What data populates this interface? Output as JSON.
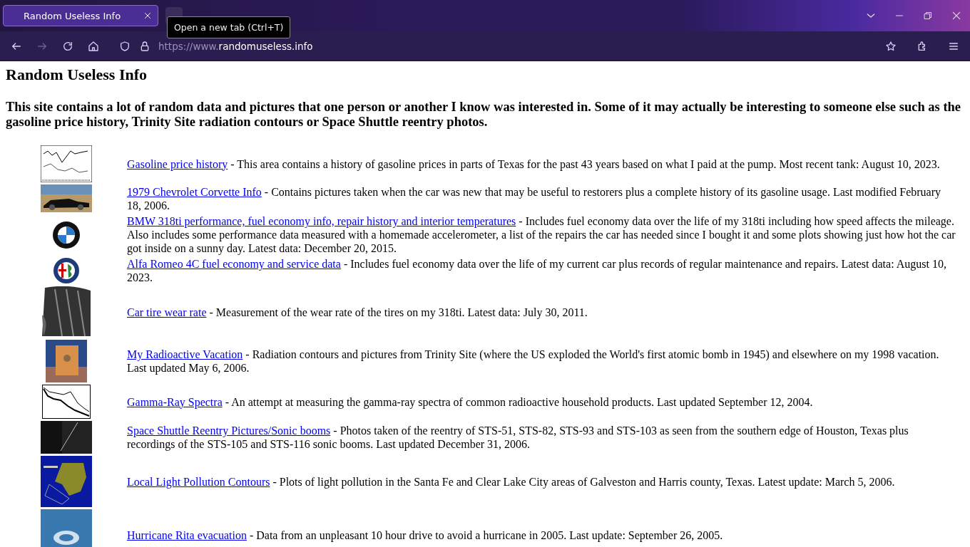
{
  "browser": {
    "tabs": [
      {
        "title": "Random Useless Info",
        "selected": true
      }
    ],
    "tooltip": "Open a new tab (Ctrl+T)",
    "url": {
      "prefix": "https://www.",
      "domain": "randomuseless.info"
    }
  },
  "page": {
    "title": "Random Useless Info",
    "intro": "This site contains a lot of random data and pictures that one person or another I know was interested in. Some of it may actually be interesting to someone else such as the gasoline price history, Trinity Site radiation contours or Space Shuttle reentry photos.",
    "entries": [
      {
        "kind": "price-chart",
        "link": "Gasoline price history",
        "text": " - This area contains a history of gasoline prices in parts of Texas for the past 43 years based on what I paid at the pump. Most recent tank: August 10, 2023."
      },
      {
        "kind": "car-photo",
        "link": "1979 Chevrolet Corvette Info",
        "text": " - Contains pictures taken when the car was new that may be useful to restorers plus a complete history of its gasoline usage. Last modified February 18, 2006."
      },
      {
        "kind": "quartered-logo",
        "link": "BMW 318ti performance, fuel economy info, repair history and interior temperatures",
        "text": " - Includes fuel economy data over the life of my 318ti including how speed affects the mileage. Also includes some performance data measured with a homemade accelerometer, a list of the repairs the car has needed since I bought it and some plots showing just how hot the car got inside on a sunny day. Latest data: December 20, 2015."
      },
      {
        "kind": "split-logo",
        "link": "Alfa Romeo 4C fuel economy and service data",
        "text": " - Includes fuel economy data over the life of my current car plus records of regular maintenance and repairs. Latest data: August 10, 2023."
      },
      {
        "kind": "tire-photo",
        "link": "Car tire wear rate",
        "text": " - Measurement of the wear rate of the tires on my 318ti. Latest data: July 30, 2011."
      },
      {
        "kind": "sign-photo",
        "link": "My Radioactive Vacation",
        "text": " - Radiation contours and pictures from Trinity Site (where the US exploded the World's first atomic bomb in 1945) and elsewhere on my 1998 vacation. Last updated May 6, 2006."
      },
      {
        "kind": "spectrum-chart",
        "link": "Gamma-Ray Spectra",
        "text": " - An attempt at measuring the gamma-ray spectra of common radioactive household products. Last updated September 12, 2004."
      },
      {
        "kind": "night-photo",
        "link": "Space Shuttle Reentry Pictures/Sonic booms",
        "text": " - Photos taken of the reentry of STS-51, STS-82, STS-93 and STS-103 as seen from the southern edge of Houston, Texas plus recordings of the STS-105 and STS-116 sonic booms. Last updated December 31, 2006."
      },
      {
        "kind": "contour-map",
        "link": "Local Light Pollution Contours",
        "text": " - Plots of light pollution in the Santa Fe and Clear Lake City areas of Galveston and Harris county, Texas. Latest update: March 5, 2006."
      },
      {
        "kind": "storm-photo",
        "link": "Hurricane Rita evacuation",
        "text": " - Data from an unpleasant 10 hour drive to avoid a hurricane in 2005. Last update: September 26, 2005."
      }
    ]
  }
}
